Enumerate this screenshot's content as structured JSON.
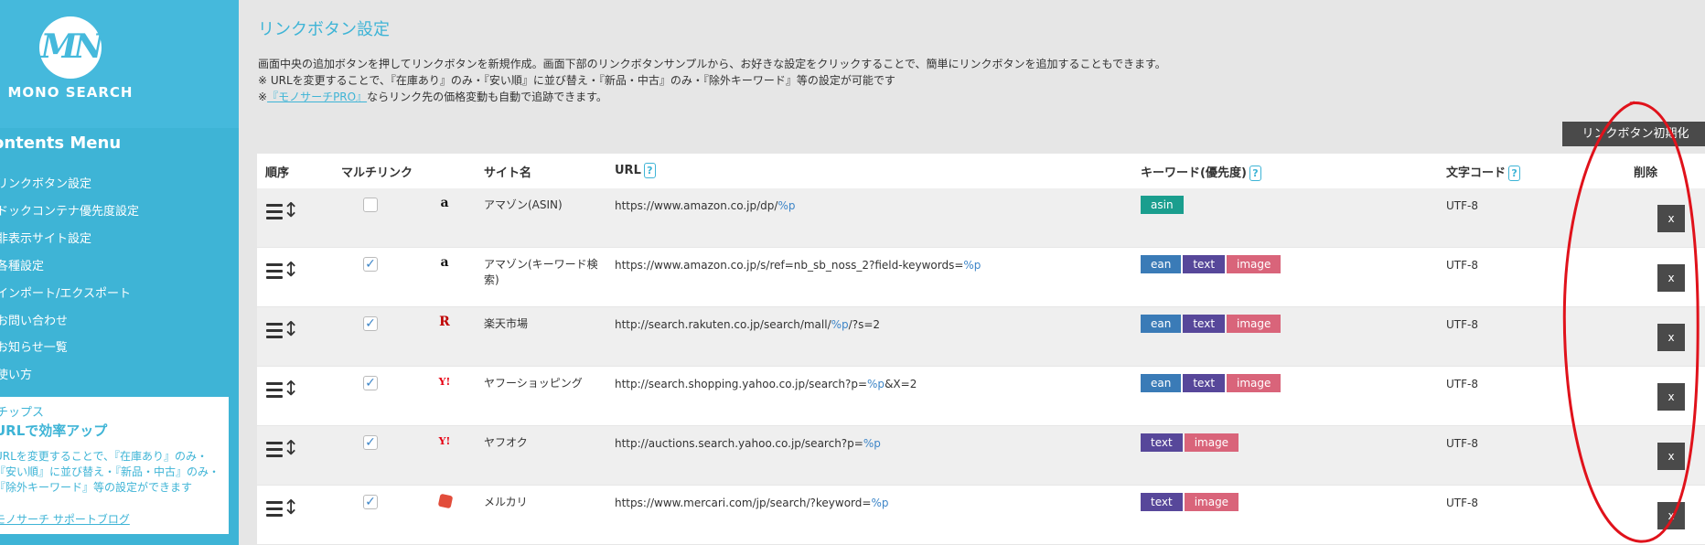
{
  "sidebar": {
    "logo_mark": "MN",
    "logo_text": "MONO SEARCH",
    "menu_title": "ontents Menu",
    "items": [
      {
        "label": "リンクボタン設定"
      },
      {
        "label": "ドックコンテナ優先度設定"
      },
      {
        "label": "非表示サイト設定"
      },
      {
        "label": "各種設定"
      },
      {
        "label": "インポート/エクスポート"
      },
      {
        "label": "お問い合わせ"
      },
      {
        "label": "お知らせ一覧"
      },
      {
        "label": "使い方"
      }
    ],
    "tips": {
      "label": "チップス",
      "heading": "URLで効率アップ",
      "lines": [
        "URLを変更することで、『在庫あり』のみ・",
        "『安い順』に並び替え・『新品・中古』のみ・",
        "『除外キーワード』等の設定ができます"
      ],
      "link": "モノサーチ サポートブログ"
    }
  },
  "main": {
    "title": "リンクボタン設定",
    "desc_lines": [
      "画面中央の追加ボタンを押してリンクボタンを新規作成。画面下部のリンクボタンサンプルから、お好きな設定をクリックすることで、簡単にリンクボタンを追加することもできます。",
      "※ URLを変更することで、『在庫あり』のみ・『安い順』に並び替え・『新品・中古』のみ・『除外キーワード』等の設定が可能です"
    ],
    "desc3_prefix": "※",
    "desc3_link": "『モノサーチPRO』",
    "desc3_suffix": "ならリンク先の価格変動も自動で追跡できます。",
    "reset_button": "リンクボタン初期化",
    "table": {
      "headers": {
        "order": "順序",
        "multilink": "マルチリンク",
        "site_name": "サイト名",
        "url": "URL",
        "keyword": "キーワード(優先度)",
        "encoding": "文字コード",
        "delete": "削除",
        "help": "?"
      },
      "rows": [
        {
          "checked": false,
          "icon": "amazon-icon",
          "icon_char": "a",
          "site": "アマゾン(ASIN)",
          "url": "https://www.amazon.co.jp/dp/",
          "ph": "%p",
          "url_suffix": "",
          "tags": [
            "asin"
          ],
          "encoding": "UTF-8",
          "delete": "x"
        },
        {
          "checked": true,
          "icon": "amazon-icon",
          "icon_char": "a",
          "site": "アマゾン(キーワード検索)",
          "url": "https://www.amazon.co.jp/s/ref=nb_sb_noss_2?field-keywords=",
          "ph": "%p",
          "url_suffix": "",
          "tags": [
            "ean",
            "text",
            "image"
          ],
          "encoding": "UTF-8",
          "delete": "x"
        },
        {
          "checked": true,
          "icon": "rakuten-icon",
          "icon_char": "R",
          "site": "楽天市場",
          "url": "http://search.rakuten.co.jp/search/mall/",
          "ph": "%p",
          "url_suffix": "/?s=2",
          "tags": [
            "ean",
            "text",
            "image"
          ],
          "encoding": "UTF-8",
          "delete": "x"
        },
        {
          "checked": true,
          "icon": "yahoo-icon",
          "icon_char": "Y!",
          "site": "ヤフーショッピング",
          "url": "http://search.shopping.yahoo.co.jp/search?p=",
          "ph": "%p",
          "url_suffix": "&X=2",
          "tags": [
            "ean",
            "text",
            "image"
          ],
          "encoding": "UTF-8",
          "delete": "x"
        },
        {
          "checked": true,
          "icon": "yahoo-icon",
          "icon_char": "Y!",
          "site": "ヤフオク",
          "url": "http://auctions.search.yahoo.co.jp/search?p=",
          "ph": "%p",
          "url_suffix": "",
          "tags": [
            "text",
            "image"
          ],
          "encoding": "UTF-8",
          "delete": "x"
        },
        {
          "checked": true,
          "icon": "mercari-icon",
          "icon_char": "",
          "site": "メルカリ",
          "url": "https://www.mercari.com/jp/search/?keyword=",
          "ph": "%p",
          "url_suffix": "",
          "tags": [
            "text",
            "image"
          ],
          "encoding": "UTF-8",
          "delete": "x"
        }
      ]
    }
  },
  "colors": {
    "sidebar": "#3eb4d6",
    "accent": "#3eb4d6",
    "annotation": "#e0121b"
  }
}
